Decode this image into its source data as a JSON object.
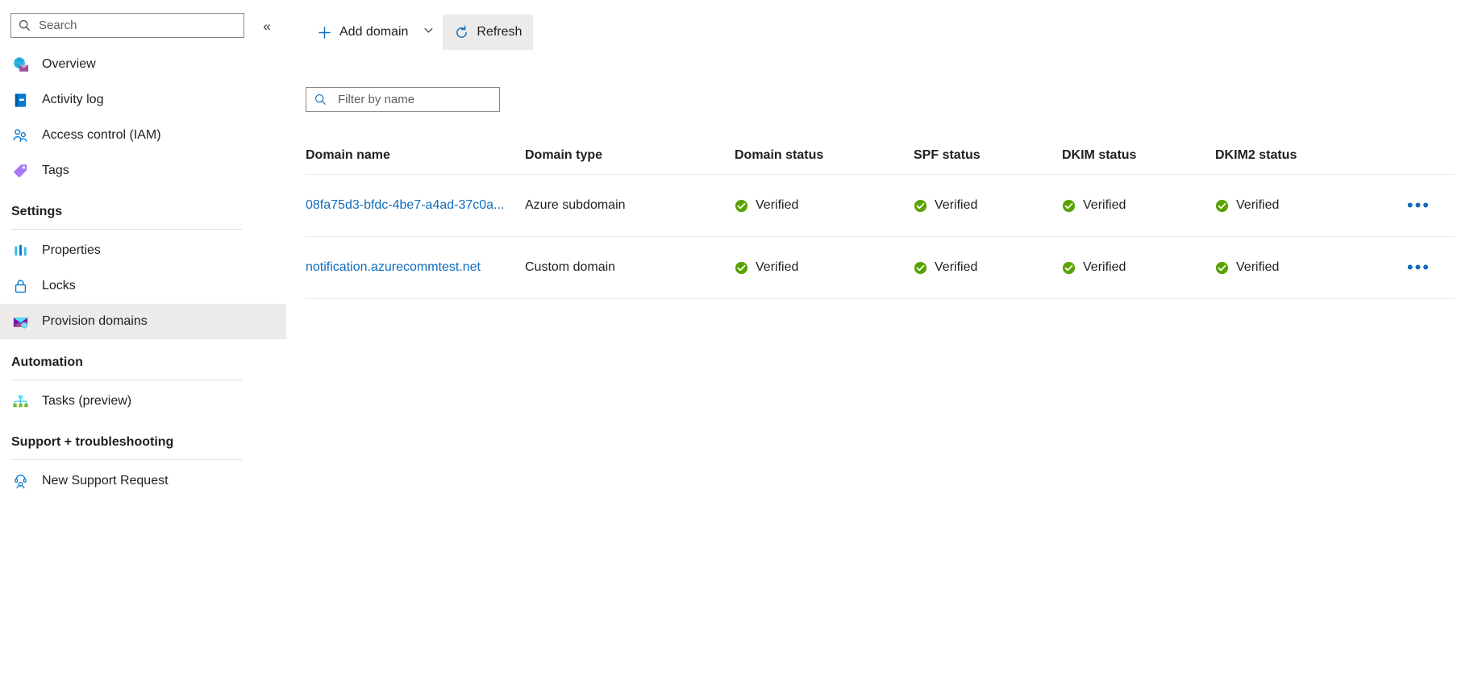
{
  "sidebar": {
    "search": {
      "placeholder": "Search",
      "value": "",
      "icon": "search-icon"
    },
    "collapse": {
      "icon": "chevron-double-left-icon",
      "glyph": "«"
    },
    "items": [
      {
        "label": "Overview",
        "icon": "communication-service-icon",
        "selected": false
      },
      {
        "label": "Activity log",
        "icon": "activity-log-icon",
        "selected": false
      },
      {
        "label": "Access control (IAM)",
        "icon": "access-control-icon",
        "selected": false
      },
      {
        "label": "Tags",
        "icon": "tags-icon",
        "selected": false
      }
    ],
    "groups": [
      {
        "title": "Settings",
        "items": [
          {
            "label": "Properties",
            "icon": "properties-icon",
            "selected": false
          },
          {
            "label": "Locks",
            "icon": "lock-icon",
            "selected": false
          },
          {
            "label": "Provision domains",
            "icon": "provision-domains-icon",
            "selected": true
          }
        ]
      },
      {
        "title": "Automation",
        "items": [
          {
            "label": "Tasks (preview)",
            "icon": "tasks-icon",
            "selected": false
          }
        ]
      },
      {
        "title": "Support + troubleshooting",
        "items": [
          {
            "label": "New Support Request",
            "icon": "support-request-icon",
            "selected": false
          }
        ]
      }
    ]
  },
  "toolbar": {
    "add_domain_label": "Add domain",
    "add_domain_icon": "plus-icon",
    "add_domain_caret_icon": "chevron-down-icon",
    "refresh_label": "Refresh",
    "refresh_icon": "refresh-icon",
    "refresh_active": true
  },
  "filter": {
    "placeholder": "Filter by name",
    "value": "",
    "icon": "search-icon"
  },
  "table": {
    "columns": [
      {
        "key": "name",
        "label": "Domain name"
      },
      {
        "key": "type",
        "label": "Domain type"
      },
      {
        "key": "dstat",
        "label": "Domain status"
      },
      {
        "key": "spf",
        "label": "SPF status"
      },
      {
        "key": "dkim",
        "label": "DKIM status"
      },
      {
        "key": "dkim2",
        "label": "DKIM2 status"
      }
    ],
    "rows": [
      {
        "name": "08fa75d3-bfdc-4be7-a4ad-37c0a...",
        "type": "Azure subdomain",
        "dstat": "Verified",
        "spf": "Verified",
        "dkim": "Verified",
        "dkim2": "Verified",
        "menu_icon": "more-options-icon",
        "menu_glyph": "•••"
      },
      {
        "name": "notification.azurecommtest.net",
        "type": "Custom domain",
        "dstat": "Verified",
        "spf": "Verified",
        "dkim": "Verified",
        "dkim2": "Verified",
        "menu_icon": "more-options-icon",
        "menu_glyph": "•••"
      }
    ]
  },
  "colors": {
    "link": "#0f6cbd",
    "verified_green": "#57a300",
    "selected_row_bg": "#edebe9",
    "border": "#8a8886",
    "grid_line": "#edebe9"
  }
}
